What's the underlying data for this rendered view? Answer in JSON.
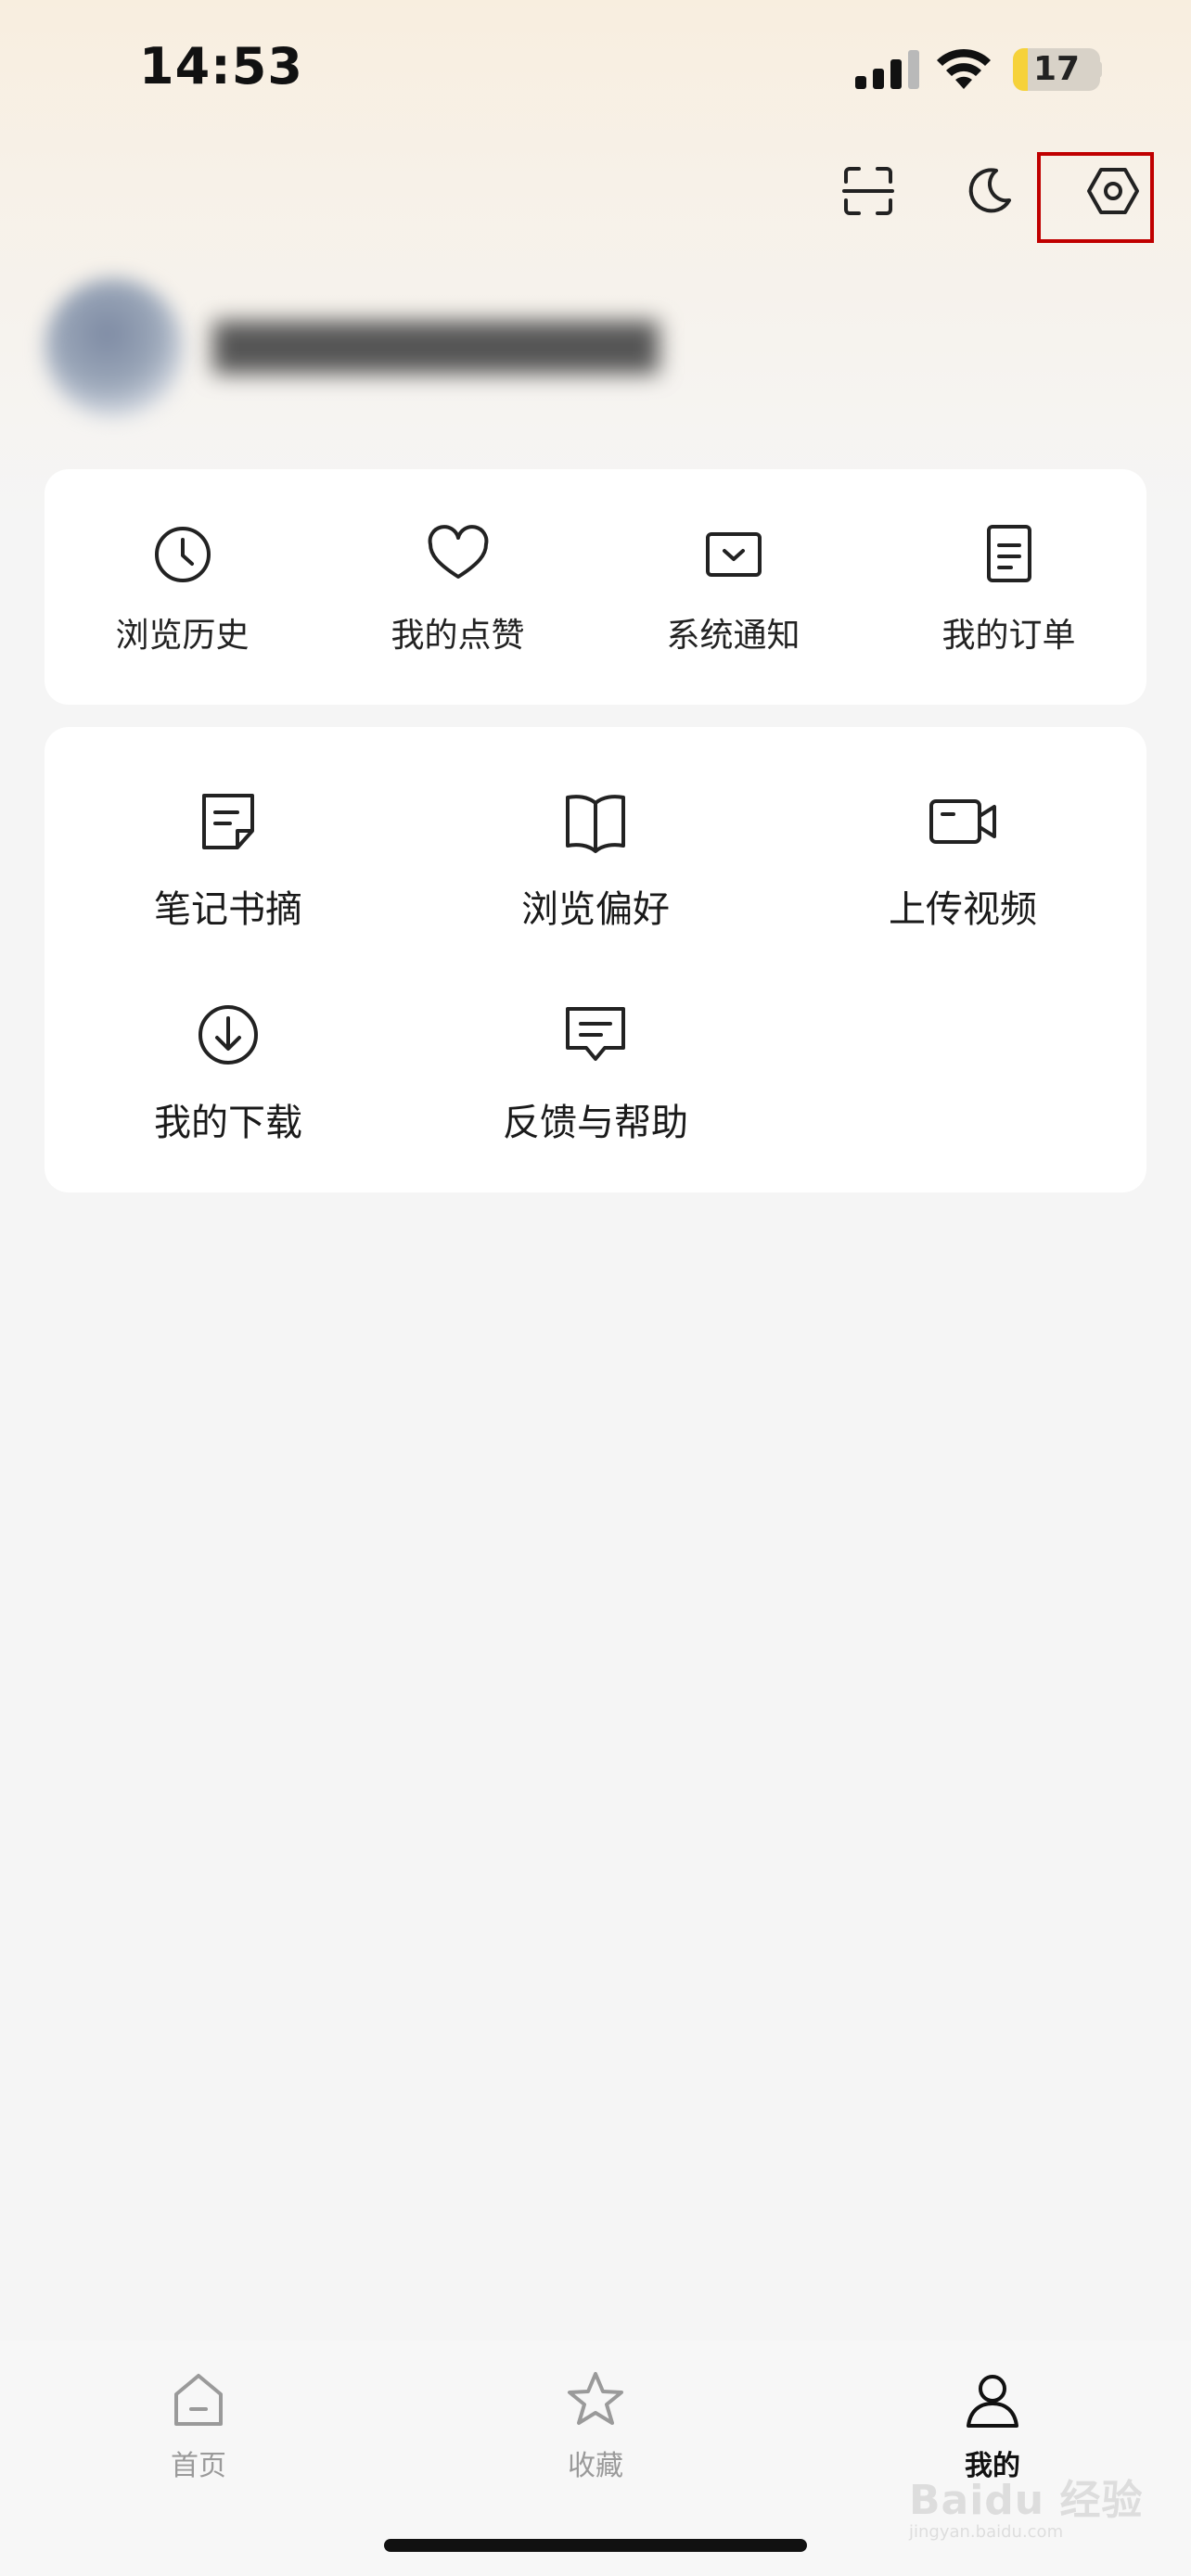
{
  "status_bar": {
    "time": "14:53",
    "battery": "17",
    "battery_level": 0.17,
    "signal_icon": "cellular-signal-icon",
    "wifi_icon": "wifi-icon"
  },
  "top_actions": {
    "scan_icon": "scan-icon",
    "dark_mode_icon": "moon-icon",
    "settings_icon": "settings-hexagon-icon",
    "highlight_color": "#c00000"
  },
  "quick_links": [
    {
      "label": "浏览历史",
      "icon": "clock-icon"
    },
    {
      "label": "我的点赞",
      "icon": "heart-icon"
    },
    {
      "label": "系统通知",
      "icon": "inbox-icon"
    },
    {
      "label": "我的订单",
      "icon": "document-icon"
    }
  ],
  "tools": [
    {
      "label": "笔记书摘",
      "icon": "note-icon"
    },
    {
      "label": "浏览偏好",
      "icon": "book-icon"
    },
    {
      "label": "上传视频",
      "icon": "video-camera-icon"
    },
    {
      "label": "我的下载",
      "icon": "download-icon"
    },
    {
      "label": "反馈与帮助",
      "icon": "feedback-bubble-icon"
    }
  ],
  "tab_bar": {
    "tabs": [
      {
        "label": "首页",
        "icon": "home-icon",
        "active": false
      },
      {
        "label": "收藏",
        "icon": "star-icon",
        "active": false
      },
      {
        "label": "我的",
        "icon": "user-icon",
        "active": true
      }
    ]
  },
  "watermark": {
    "logo": "Baidu 经验",
    "url": "jingyan.baidu.com"
  }
}
